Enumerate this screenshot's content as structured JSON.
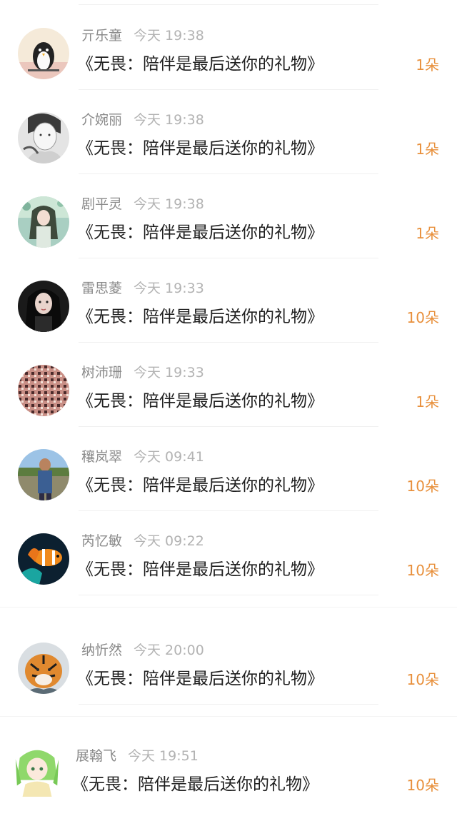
{
  "messages": [
    {
      "name": "亓乐童",
      "time": "今天 19:38",
      "text": "《无畏：陪伴是最后送你的礼物》",
      "count": "1朵",
      "avatar": "penguin-avatar"
    },
    {
      "name": "介婉丽",
      "time": "今天 19:38",
      "text": "《无畏：陪伴是最后送你的礼物》",
      "count": "1朵",
      "avatar": "boy-sketch-avatar"
    },
    {
      "name": "剧平灵",
      "time": "今天 19:38",
      "text": "《无畏：陪伴是最后送你的礼物》",
      "count": "1朵",
      "avatar": "girl-green-avatar"
    },
    {
      "name": "雷思菱",
      "time": "今天 19:33",
      "text": "《无畏：陪伴是最后送你的礼物》",
      "count": "10朵",
      "avatar": "girl-dark-avatar"
    },
    {
      "name": "树沛珊",
      "time": "今天 19:33",
      "text": "《无畏：陪伴是最后送你的礼物》",
      "count": "1朵",
      "avatar": "pattern-avatar"
    },
    {
      "name": "穰岚翠",
      "time": "今天 09:41",
      "text": "《无畏：陪伴是最后送你的礼物》",
      "count": "10朵",
      "avatar": "man-outdoor-avatar"
    },
    {
      "name": "芮忆敏",
      "time": "今天 09:22",
      "text": "《无畏：陪伴是最后送你的礼物》",
      "count": "10朵",
      "avatar": "clownfish-avatar"
    },
    {
      "name": "纳忻然",
      "time": "今天 20:00",
      "text": "《无畏：陪伴是最后送你的礼物》",
      "count": "10朵",
      "avatar": "tiger-avatar"
    },
    {
      "name": "展翰飞",
      "time": "今天 19:51",
      "text": "《无畏：陪伴是最后送你的礼物》",
      "count": "10朵",
      "avatar": "anime-girl-avatar"
    }
  ],
  "colors": {
    "count": "#e8903c",
    "name": "#8a8a8a",
    "time": "#b3b3b3",
    "text": "#1f1f1f"
  }
}
